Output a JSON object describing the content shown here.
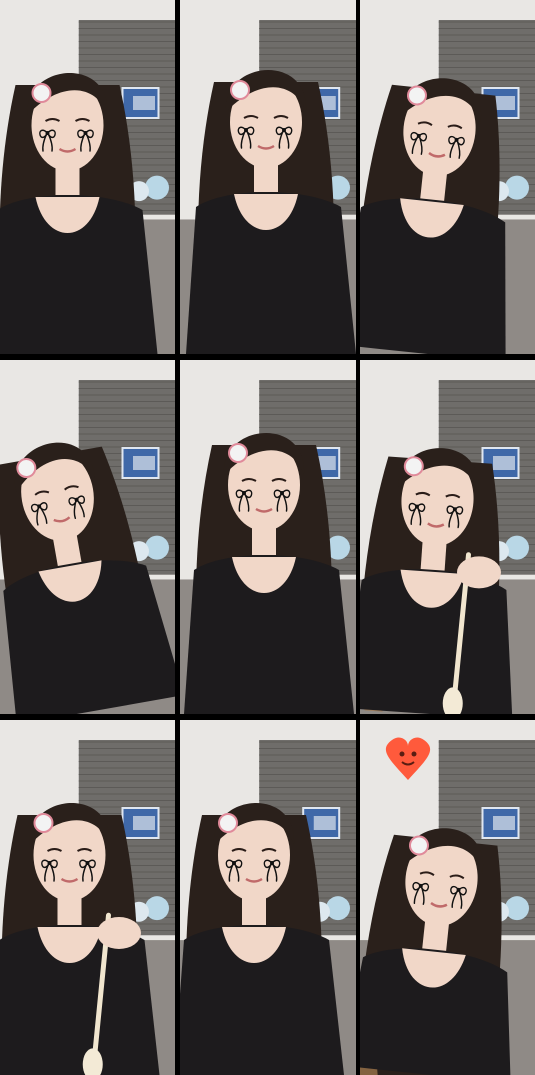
{
  "grid": {
    "rows": 3,
    "columns": 3,
    "divider_color": "#000000"
  },
  "palette": {
    "wall": "#e9e7e4",
    "wallpaper": "#6f6d6a",
    "hair": "#2a201b",
    "hair_tips": "#a37a4f",
    "skin": "#f1d7c8",
    "shirt": "#1d1b1d",
    "pants": "#eee4c8",
    "sticker_ink": "#111111",
    "hair_clip": "#f3f3f3",
    "heart": "#ff5a3c"
  },
  "frames": [
    {
      "pose": "eyes-closed-squint",
      "sticker": "bow-tears",
      "prop": "none"
    },
    {
      "pose": "smile-front",
      "sticker": "bow-tears",
      "prop": "none"
    },
    {
      "pose": "looking-down-smile",
      "sticker": "bow-tears",
      "prop": "none"
    },
    {
      "pose": "head-tilt-hand-on-cheek",
      "sticker": "bow-tears",
      "prop": "none"
    },
    {
      "pose": "talking-front",
      "sticker": "bow-tears",
      "prop": "none"
    },
    {
      "pose": "eyes-closed-eating",
      "sticker": "bow-tears",
      "prop": "spoon"
    },
    {
      "pose": "eating-spoon",
      "sticker": "bow-tears",
      "prop": "spoon"
    },
    {
      "pose": "reaching-down",
      "sticker": "bow-tears",
      "prop": "none"
    },
    {
      "pose": "hand-on-chest",
      "sticker": "bow-tears",
      "prop": "heart-emoji"
    }
  ]
}
